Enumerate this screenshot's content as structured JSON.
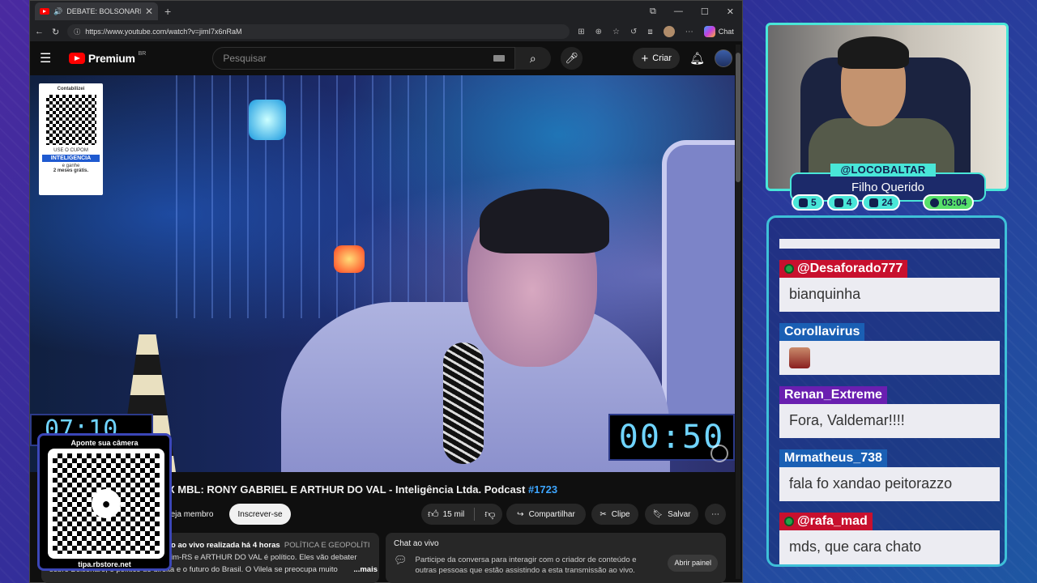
{
  "browser": {
    "tab_title": "DEBATE: BOLSONARISTA X M",
    "url": "https://www.youtube.com/watch?v=jimI7x6nRaM",
    "chat_label": "Chat"
  },
  "youtube": {
    "logo_text": "Premium",
    "region": "BR",
    "search_placeholder": "Pesquisar",
    "create_label": "Criar"
  },
  "ad": {
    "top": "Contabilizei",
    "small": "USE O CUPOM",
    "code": "INTELIGENCIA",
    "line1": "e ganhe",
    "line2": "2 meses grátis."
  },
  "video": {
    "timer_right": "00:50",
    "timer_left": "07:10",
    "title_visible": "X MBL: RONY GABRIEL E ARTHUR DO VAL - Inteligência Ltda. Podcast ",
    "title_tag": "#1723"
  },
  "actions": {
    "member": "eja membro",
    "subscribe": "Inscrever-se",
    "likes": "15 mil",
    "share": "Compartilhar",
    "clip": "Clipe",
    "save": "Salvar"
  },
  "description": {
    "line1": "o ao vivo realizada há 4 horas",
    "category": "POLÍTICA E GEOPOLÍTI",
    "line2": "im-RS e ARTHUR DO VAL é político. Eles vão debater",
    "line3": "sobre Bolsonaro, o político de direita e o futuro do Brasil. O Vilela se preocupa muito",
    "more": "...mais"
  },
  "live_chat": {
    "header": "Chat ao vivo",
    "text": "Participe da conversa para interagir com o criador de conteúdo e outras pessoas que estão assistindo a esta transmissão ao vivo.",
    "open_panel": "Abrir painel"
  },
  "overlay_qr": {
    "caption": "Aponte sua câmera",
    "url": "tipa.rbstore.net"
  },
  "streamer": {
    "handle": "@LOCOBALTAR",
    "name": "Filho Querido",
    "stats": [
      {
        "icon": "chat-icon",
        "value": "5"
      },
      {
        "icon": "youtube-icon",
        "value": "4"
      },
      {
        "icon": "link-icon",
        "value": "24"
      },
      {
        "icon": "whatsapp-icon",
        "value": "03:04"
      }
    ]
  },
  "chat_overlay": [
    {
      "user": "@Desaforado777",
      "text": "bianquinha",
      "color": "#c8102e",
      "sub": true
    },
    {
      "user": "Corollavirus",
      "text": "",
      "color": "#1a5fb4",
      "sub": false,
      "emote": true
    },
    {
      "user": "Renan_Extreme",
      "text": "Fora, Valdemar!!!!",
      "color": "#6a1fb0",
      "sub": false
    },
    {
      "user": "Mrmatheus_738",
      "text": "fala fo xandao peitorazzo",
      "color": "#1a5fb4",
      "sub": false
    },
    {
      "user": "@rafa_mad",
      "text": "mds, que cara chato",
      "color": "#c8102e",
      "sub": true
    }
  ]
}
